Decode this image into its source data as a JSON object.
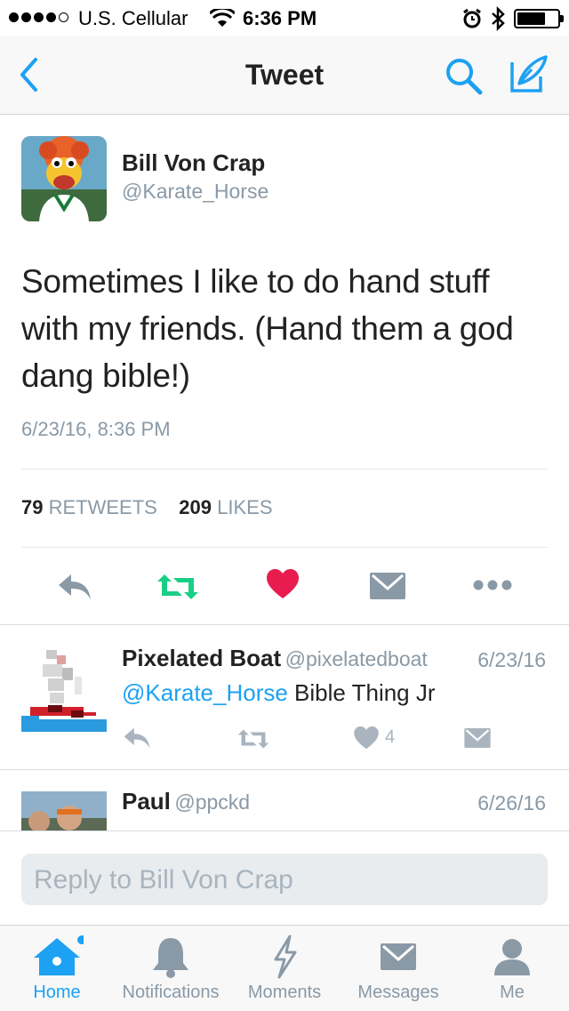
{
  "status_bar": {
    "carrier": "U.S. Cellular",
    "time": "6:36 PM",
    "signal_bars": 4,
    "battery_level": 0.65
  },
  "nav": {
    "title": "Tweet",
    "back_icon": "chevron-left-icon",
    "search_icon": "search-icon",
    "compose_icon": "compose-icon"
  },
  "tweet": {
    "author_name": "Bill Von Crap",
    "author_handle": "@Karate_Horse",
    "text": "Sometimes I like to do hand stuff with my friends. (Hand them a god dang bible!)",
    "date": "6/23/16, 8:36 PM",
    "retweets_count": "79",
    "retweets_label": "RETWEETS",
    "likes_count": "209",
    "likes_label": "LIKES",
    "liked": true,
    "colors": {
      "retweet": "#19cf86",
      "like": "#e81c4f",
      "gray": "#8a99a6",
      "accent": "#1da1f2"
    }
  },
  "replies": [
    {
      "name": "Pixelated Boat",
      "handle": "@pixelatedboat",
      "date": "6/23/16",
      "mention": "@Karate_Horse",
      "text": " Bible Thing Jr",
      "likes": "4"
    },
    {
      "name": "Paul",
      "handle": "@ppckd",
      "date": "6/26/16"
    }
  ],
  "reply_bar": {
    "placeholder": "Reply to Bill Von Crap"
  },
  "tabs": [
    {
      "label": "Home",
      "icon": "home-icon",
      "active": true
    },
    {
      "label": "Notifications",
      "icon": "bell-icon",
      "active": false
    },
    {
      "label": "Moments",
      "icon": "lightning-icon",
      "active": false
    },
    {
      "label": "Messages",
      "icon": "envelope-icon",
      "active": false
    },
    {
      "label": "Me",
      "icon": "person-icon",
      "active": false
    }
  ]
}
